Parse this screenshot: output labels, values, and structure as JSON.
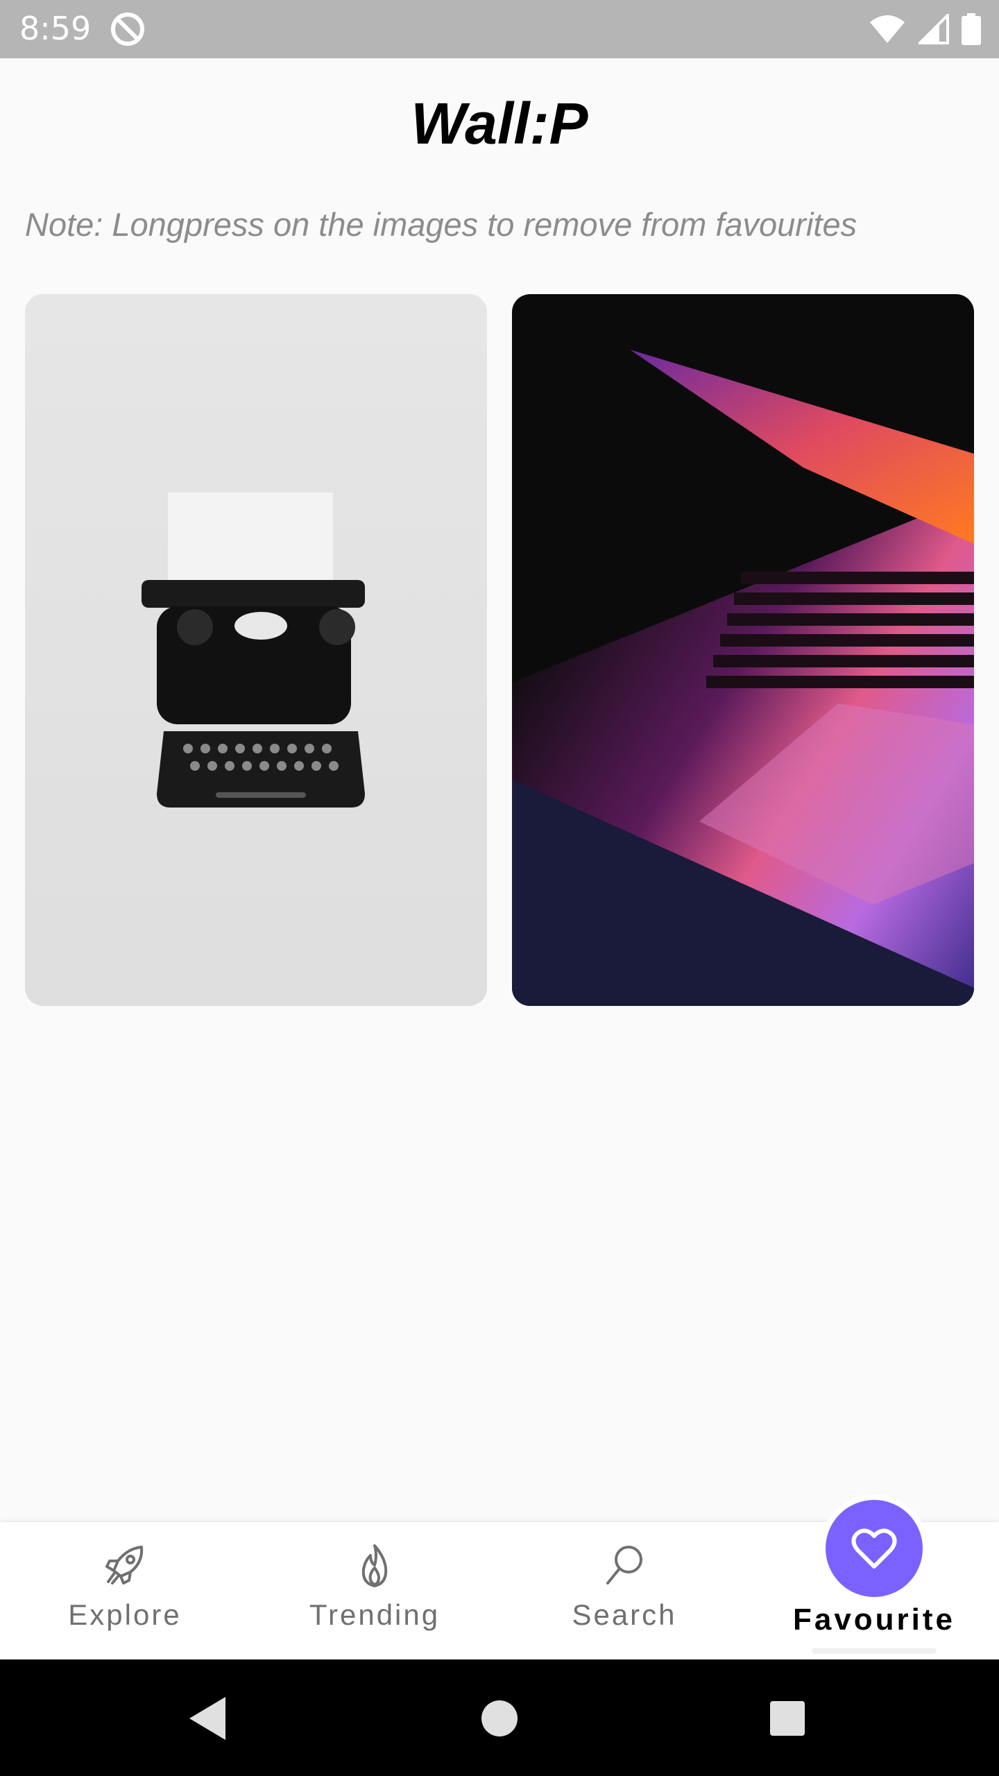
{
  "status_bar": {
    "time": "8:59",
    "icons": [
      "sync-icon",
      "wifi-icon",
      "signal-icon",
      "battery-icon"
    ]
  },
  "header": {
    "title": "Wall:P"
  },
  "note": "Note: Longpress on the images to remove from favourites",
  "favourites": [
    {
      "subject": "typewriter-photo"
    },
    {
      "subject": "laptop-keyboard-photo"
    }
  ],
  "bottom_nav": {
    "items": [
      {
        "label": "Explore",
        "icon": "rocket-icon",
        "active": false
      },
      {
        "label": "Trending",
        "icon": "flame-icon",
        "active": false
      },
      {
        "label": "Search",
        "icon": "search-icon",
        "active": false
      },
      {
        "label": "Favourite",
        "icon": "heart-icon",
        "active": true
      }
    ]
  },
  "colors": {
    "accent": "#7b61ff",
    "inactive": "#707070",
    "note": "#8c8c8c"
  }
}
